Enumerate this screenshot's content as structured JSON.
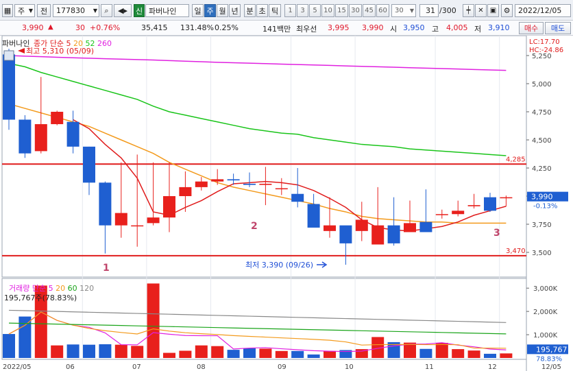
{
  "toolbar": {
    "market": "주",
    "prefix": "전",
    "code": "177830",
    "new_badge": "신",
    "stock_name": "파버나인",
    "periods": [
      "일",
      "주",
      "월",
      "년",
      "분",
      "초",
      "틱"
    ],
    "active_period": "주",
    "intervals": [
      "1",
      "3",
      "5",
      "10",
      "15",
      "30",
      "45",
      "60"
    ],
    "interval_input": "30",
    "count": "31",
    "count_max": "/300",
    "date": "2022/12/05"
  },
  "quote": {
    "price": "3,990",
    "change": "30",
    "change_pct": "+0.76%",
    "volume": "35,415",
    "vol_ratio": "131.48%",
    "turnover": "0.25%",
    "trade_value": "141백만",
    "best_ask_label": "최우선",
    "best_ask": "3,995",
    "best_bid": "3,990",
    "open_label": "시",
    "open": "3,950",
    "high_label": "고",
    "high": "4,005",
    "low_label": "저",
    "low": "3,910",
    "buy_label": "매수",
    "sell_label": "매도"
  },
  "price_legend": {
    "name": "파버나인",
    "ma_label": "종가 단순",
    "ma_periods": [
      "5",
      "20",
      "52",
      "260"
    ],
    "ma_colors": [
      "#e01b1b",
      "#f39a1c",
      "#19c419",
      "#e020e0"
    ]
  },
  "volume_legend": {
    "name": "거래량",
    "ma_label": "단순",
    "ma_periods": [
      "5",
      "20",
      "60",
      "120"
    ],
    "ma_colors": [
      "#e020e0",
      "#f39a1c",
      "#19a419",
      "#888888"
    ],
    "current": "195,767주(78.83%)"
  },
  "price_axis": {
    "ticks": [
      "5,250",
      "5,000",
      "4,750",
      "4,500",
      "4,250",
      "4,000",
      "3,750",
      "3,500"
    ],
    "top_labels": [
      "LC:17.70",
      "HC:-24.86"
    ],
    "current_price": "3,990",
    "current_change": "-0.13%",
    "line_4285": "4,285",
    "line_3470": "3,470"
  },
  "volume_axis": {
    "ticks": [
      "3,000K",
      "2,000K",
      "1,000K"
    ],
    "current": "195,767",
    "current_pct": "78.83%"
  },
  "annotations": {
    "high": "최고 5,310 (05/09)",
    "low": "최저 3,390 (09/26)",
    "wave": [
      "1",
      "2",
      "3"
    ]
  },
  "date_axis": [
    "2022/05",
    "06",
    "07",
    "08",
    "09",
    "10",
    "11",
    "12",
    "12/05"
  ],
  "colors": {
    "up": "#e8201c",
    "down": "#1f5fd1",
    "ref_line": "#e01b1b"
  },
  "chart_data": {
    "type": "candlestick",
    "x": [
      "05/02",
      "05/09",
      "05/16",
      "05/23",
      "05/30",
      "06/06",
      "06/13",
      "06/20",
      "06/27",
      "07/04",
      "07/11",
      "07/18",
      "07/25",
      "08/01",
      "08/08",
      "08/15",
      "08/22",
      "08/29",
      "09/05",
      "09/12",
      "09/19",
      "09/26",
      "10/03",
      "10/10",
      "10/17",
      "10/24",
      "10/31",
      "11/07",
      "11/14",
      "11/21",
      "11/28",
      "12/05"
    ],
    "open": [
      5260,
      4680,
      4400,
      4640,
      4660,
      4440,
      4120,
      3740,
      3740,
      3760,
      3810,
      4000,
      4080,
      4130,
      4150,
      4110,
      4100,
      4070,
      4020,
      3930,
      3690,
      3740,
      3690,
      3570,
      3740,
      3680,
      3770,
      3840,
      3840,
      3910,
      3990,
      3990
    ],
    "close": [
      4680,
      4380,
      4640,
      4750,
      4440,
      4120,
      3740,
      3850,
      3740,
      3810,
      4000,
      4080,
      4130,
      4150,
      4140,
      4100,
      4110,
      4070,
      3950,
      3720,
      3740,
      3580,
      3790,
      3740,
      3580,
      3760,
      3680,
      3840,
      3870,
      3920,
      3870,
      3990
    ],
    "high": [
      5310,
      4720,
      5060,
      4760,
      4760,
      4440,
      4130,
      4300,
      4370,
      4300,
      4300,
      4220,
      4170,
      4240,
      4200,
      4210,
      4260,
      4160,
      4250,
      4020,
      3990,
      3700,
      3950,
      4080,
      3990,
      3960,
      4060,
      3880,
      3960,
      4020,
      4030,
      4005
    ],
    "low": [
      4590,
      4340,
      4380,
      4630,
      4380,
      4010,
      3490,
      3630,
      3550,
      3740,
      3680,
      3860,
      4050,
      4100,
      4100,
      4080,
      3920,
      4010,
      3900,
      3770,
      3630,
      3390,
      3600,
      3620,
      3560,
      3690,
      3700,
      3800,
      3820,
      3890,
      3860,
      3910
    ],
    "volume": [
      1030,
      1780,
      3110,
      540,
      580,
      570,
      590,
      570,
      520,
      3200,
      220,
      310,
      540,
      510,
      350,
      420,
      400,
      300,
      300,
      150,
      300,
      340,
      380,
      900,
      680,
      660,
      390,
      650,
      380,
      320,
      180,
      196
    ],
    "ylim": [
      3390,
      5310
    ],
    "ma5": [
      null,
      null,
      null,
      null,
      4680,
      4600,
      4460,
      4340,
      4160,
      3860,
      3830,
      3900,
      3960,
      4040,
      4110,
      4120,
      4130,
      4120,
      4100,
      4050,
      3980,
      3900,
      3790,
      3720,
      3700,
      3690,
      3710,
      3730,
      3770,
      3830,
      3870,
      3910
    ],
    "ma20": [
      4820,
      4780,
      4740,
      4700,
      4660,
      4620,
      4560,
      4500,
      4440,
      4380,
      4300,
      4240,
      4180,
      4120,
      4080,
      4050,
      4020,
      3990,
      3960,
      3930,
      3890,
      3860,
      3820,
      3800,
      3790,
      3780,
      3770,
      3770,
      3760,
      3760,
      3760,
      3760
    ],
    "ma52": [
      5180,
      5150,
      5100,
      5060,
      5020,
      4980,
      4940,
      4900,
      4860,
      4800,
      4750,
      4720,
      4690,
      4660,
      4630,
      4600,
      4580,
      4560,
      4550,
      4520,
      4500,
      4480,
      4460,
      4450,
      4440,
      4420,
      4410,
      4400,
      4390,
      4380,
      4370,
      4360
    ],
    "ma260": [
      5250,
      5245,
      5240,
      5235,
      5230,
      5226,
      5222,
      5218,
      5214,
      5210,
      5205,
      5200,
      5195,
      5190,
      5186,
      5182,
      5178,
      5174,
      5170,
      5166,
      5162,
      5158,
      5154,
      5150,
      5146,
      5142,
      5138,
      5134,
      5130,
      5126,
      5122,
      5118
    ],
    "ref_lines": [
      4285,
      3470
    ]
  }
}
